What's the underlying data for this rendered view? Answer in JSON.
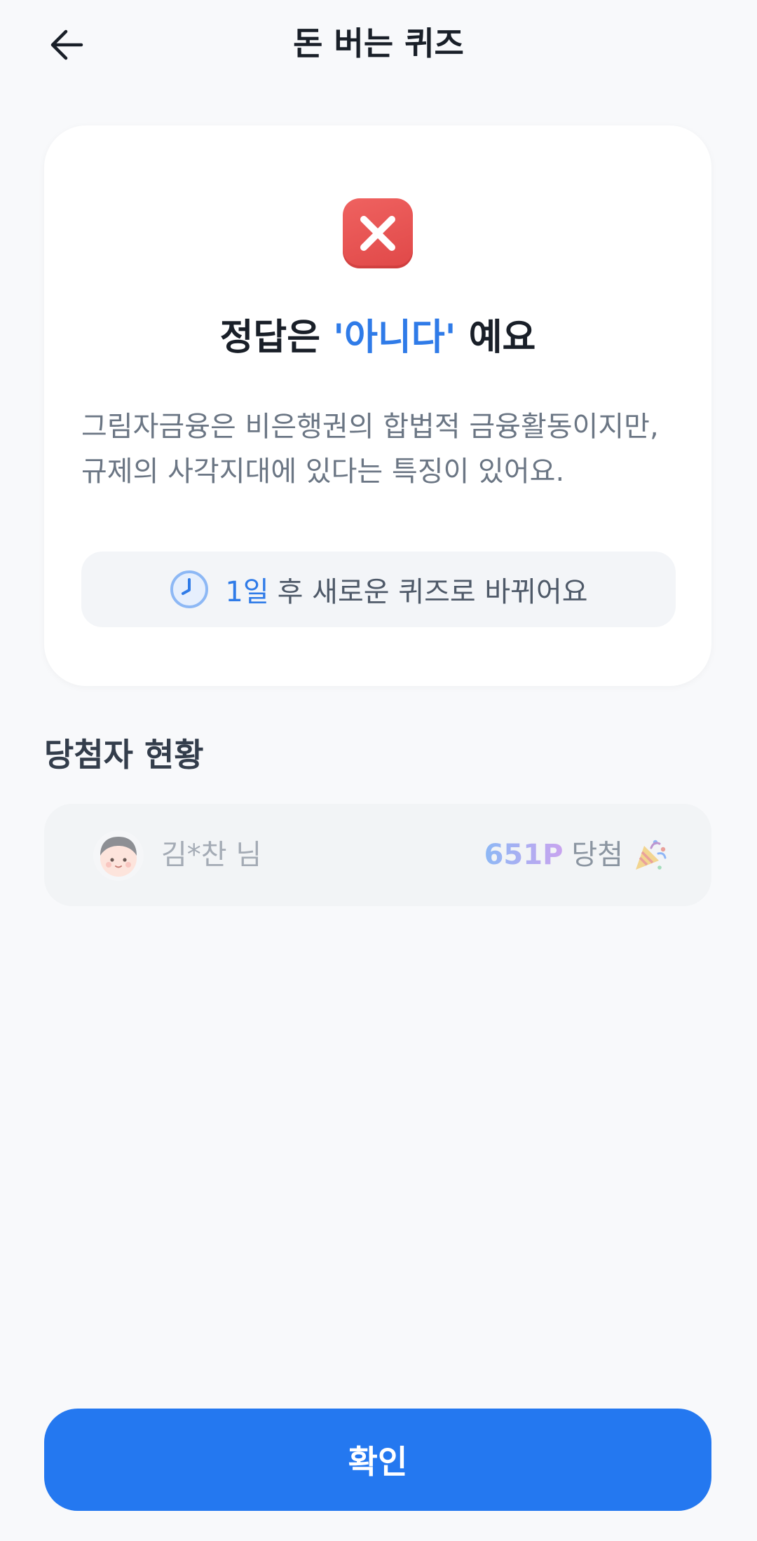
{
  "header": {
    "title": "돈 버는 퀴즈",
    "back_icon": "arrow-left-icon"
  },
  "result": {
    "status_icon": "x-mark-icon",
    "status_color": "#e55654",
    "title_prefix": "정답은 ",
    "answer": "'아니다'",
    "title_suffix": " 예요",
    "explanation_line1": "그림자금융은 비은행권의 합법적 금융활동이지만,",
    "explanation_line2": "규제의 사각지대에 있다는 특징이 있어요.",
    "countdown_icon": "clock-icon",
    "countdown_days": "1일",
    "countdown_text": "후 새로운 퀴즈로 바뀌어요"
  },
  "winners": {
    "title": "당첨자 현황",
    "items": [
      {
        "avatar_icon": "avatar-icon",
        "name": "김*찬 님",
        "points": "651P",
        "status": "당첨",
        "celebration_icon": "party-popper-icon"
      }
    ]
  },
  "footer": {
    "confirm_label": "확인",
    "accent_color": "#2478f0"
  }
}
